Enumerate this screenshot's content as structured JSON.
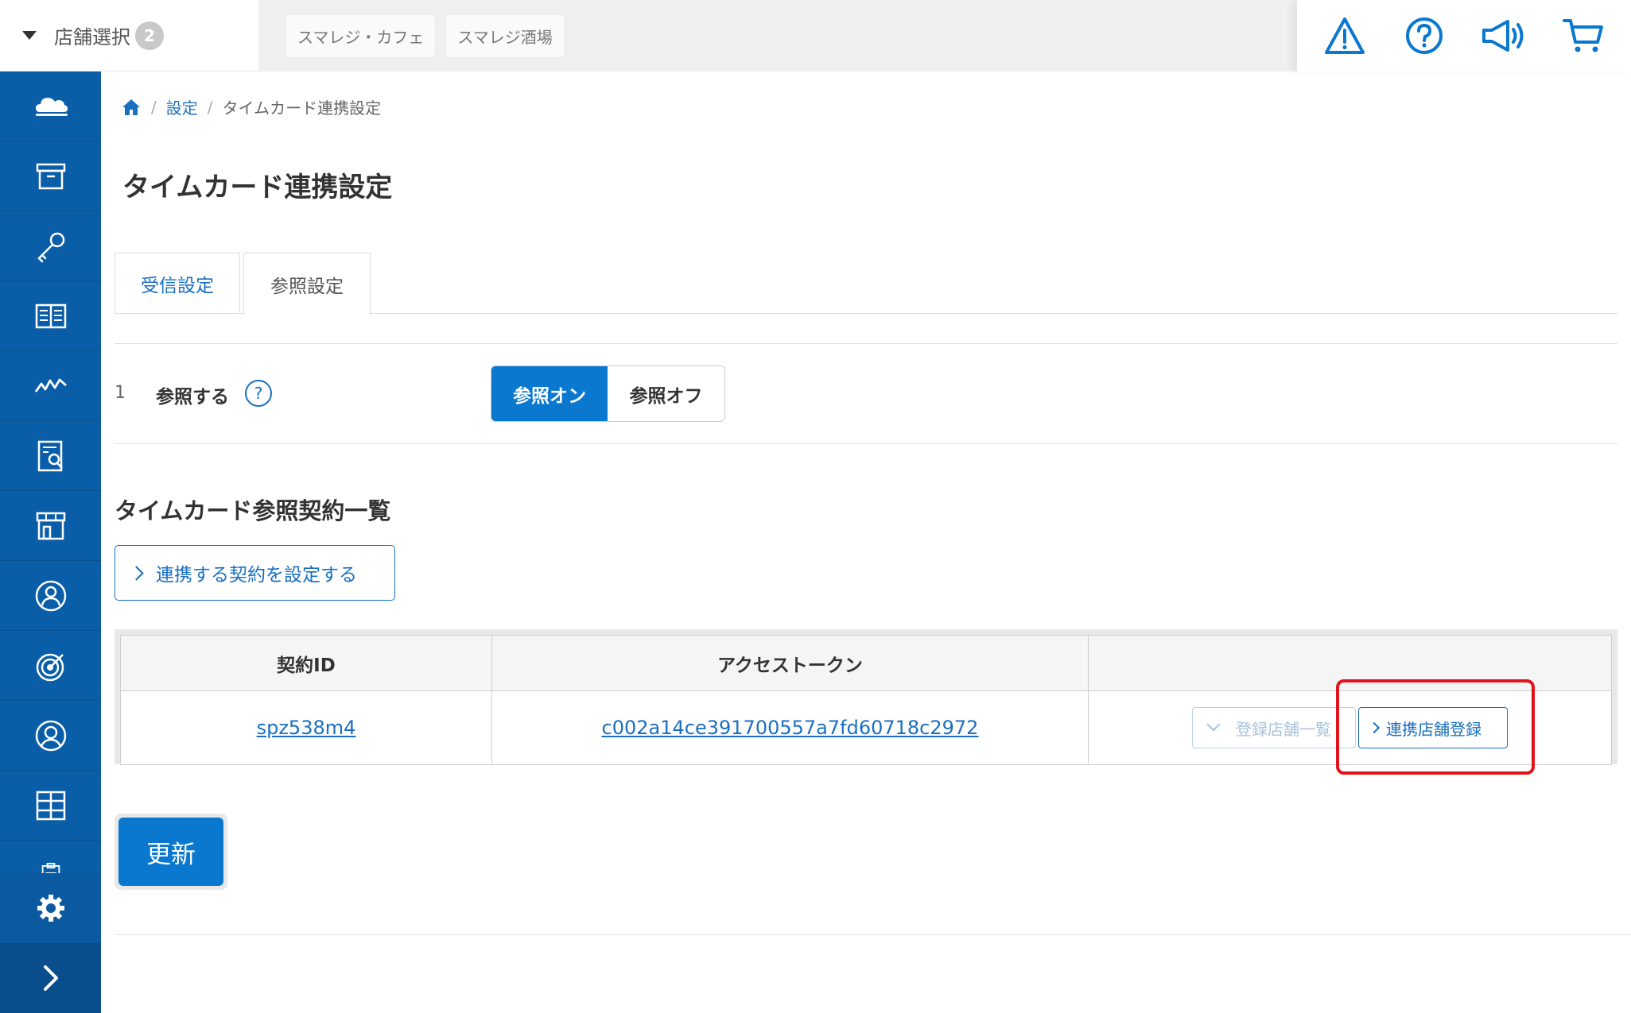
{
  "header": {
    "store_select_label": "店舗選択",
    "store_count": "2",
    "stores": [
      "スマレジ・カフェ",
      "スマレジ酒場"
    ],
    "icons": [
      "warning-icon",
      "help-icon",
      "megaphone-icon",
      "cart-icon"
    ]
  },
  "sidebar": {
    "items": [
      "cloud-icon",
      "archive-icon",
      "key-icon",
      "book-icon",
      "chart-icon",
      "report-icon",
      "store-icon",
      "user-icon",
      "target-icon",
      "person-icon",
      "grid-icon",
      "clipboard-icon"
    ],
    "bottom": [
      "gear-icon",
      "chevron-right-icon"
    ]
  },
  "breadcrumb": {
    "home_icon": "home-icon",
    "items": [
      "設定",
      "タイムカード連携設定"
    ]
  },
  "page": {
    "title": "タイムカード連携設定",
    "tabs": [
      "受信設定",
      "参照設定"
    ],
    "active_tab": "参照設定"
  },
  "setting": {
    "number": "1",
    "label": "参照する",
    "help": "?",
    "options": [
      "参照オン",
      "参照オフ"
    ],
    "selected": "参照オン"
  },
  "contracts": {
    "title": "タイムカード参照契約一覧",
    "link_button": "連携する契約を設定する",
    "columns": [
      "契約ID",
      "アクセストークン",
      ""
    ],
    "rows": [
      {
        "contract_id": "spz538m4",
        "access_token": "c002a14ce391700557a7fd60718c2972",
        "list_button": "登録店舗一覧",
        "register_button": "連携店舗登録"
      }
    ]
  },
  "footer": {
    "update_button": "更新"
  },
  "colors": {
    "brand_blue": "#0a5ea8",
    "accent_blue": "#0a78cf",
    "link_blue": "#1a6fc0",
    "highlight_red": "#e0141b"
  }
}
